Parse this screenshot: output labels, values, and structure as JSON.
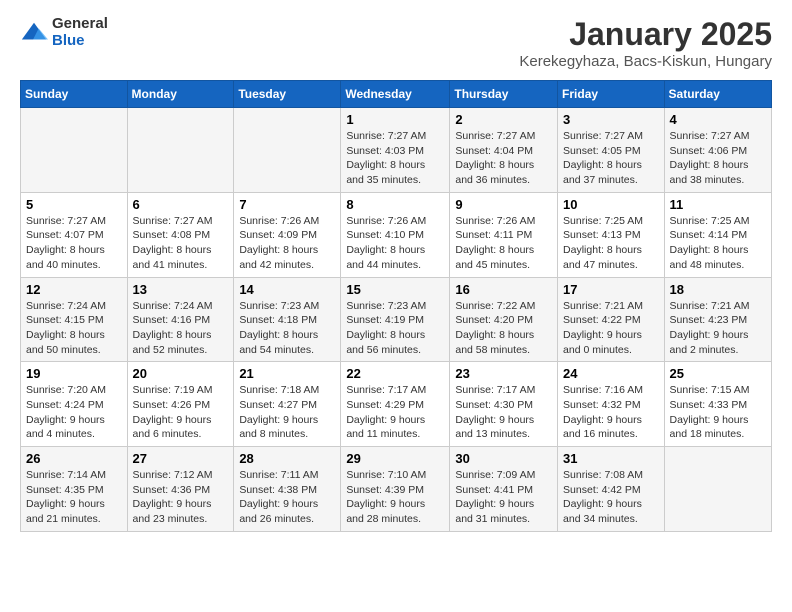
{
  "logo": {
    "general": "General",
    "blue": "Blue"
  },
  "title": "January 2025",
  "location": "Kerekegyhaza, Bacs-Kiskun, Hungary",
  "weekdays": [
    "Sunday",
    "Monday",
    "Tuesday",
    "Wednesday",
    "Thursday",
    "Friday",
    "Saturday"
  ],
  "weeks": [
    [
      {
        "day": "",
        "info": ""
      },
      {
        "day": "",
        "info": ""
      },
      {
        "day": "",
        "info": ""
      },
      {
        "day": "1",
        "info": "Sunrise: 7:27 AM\nSunset: 4:03 PM\nDaylight: 8 hours and 35 minutes."
      },
      {
        "day": "2",
        "info": "Sunrise: 7:27 AM\nSunset: 4:04 PM\nDaylight: 8 hours and 36 minutes."
      },
      {
        "day": "3",
        "info": "Sunrise: 7:27 AM\nSunset: 4:05 PM\nDaylight: 8 hours and 37 minutes."
      },
      {
        "day": "4",
        "info": "Sunrise: 7:27 AM\nSunset: 4:06 PM\nDaylight: 8 hours and 38 minutes."
      }
    ],
    [
      {
        "day": "5",
        "info": "Sunrise: 7:27 AM\nSunset: 4:07 PM\nDaylight: 8 hours and 40 minutes."
      },
      {
        "day": "6",
        "info": "Sunrise: 7:27 AM\nSunset: 4:08 PM\nDaylight: 8 hours and 41 minutes."
      },
      {
        "day": "7",
        "info": "Sunrise: 7:26 AM\nSunset: 4:09 PM\nDaylight: 8 hours and 42 minutes."
      },
      {
        "day": "8",
        "info": "Sunrise: 7:26 AM\nSunset: 4:10 PM\nDaylight: 8 hours and 44 minutes."
      },
      {
        "day": "9",
        "info": "Sunrise: 7:26 AM\nSunset: 4:11 PM\nDaylight: 8 hours and 45 minutes."
      },
      {
        "day": "10",
        "info": "Sunrise: 7:25 AM\nSunset: 4:13 PM\nDaylight: 8 hours and 47 minutes."
      },
      {
        "day": "11",
        "info": "Sunrise: 7:25 AM\nSunset: 4:14 PM\nDaylight: 8 hours and 48 minutes."
      }
    ],
    [
      {
        "day": "12",
        "info": "Sunrise: 7:24 AM\nSunset: 4:15 PM\nDaylight: 8 hours and 50 minutes."
      },
      {
        "day": "13",
        "info": "Sunrise: 7:24 AM\nSunset: 4:16 PM\nDaylight: 8 hours and 52 minutes."
      },
      {
        "day": "14",
        "info": "Sunrise: 7:23 AM\nSunset: 4:18 PM\nDaylight: 8 hours and 54 minutes."
      },
      {
        "day": "15",
        "info": "Sunrise: 7:23 AM\nSunset: 4:19 PM\nDaylight: 8 hours and 56 minutes."
      },
      {
        "day": "16",
        "info": "Sunrise: 7:22 AM\nSunset: 4:20 PM\nDaylight: 8 hours and 58 minutes."
      },
      {
        "day": "17",
        "info": "Sunrise: 7:21 AM\nSunset: 4:22 PM\nDaylight: 9 hours and 0 minutes."
      },
      {
        "day": "18",
        "info": "Sunrise: 7:21 AM\nSunset: 4:23 PM\nDaylight: 9 hours and 2 minutes."
      }
    ],
    [
      {
        "day": "19",
        "info": "Sunrise: 7:20 AM\nSunset: 4:24 PM\nDaylight: 9 hours and 4 minutes."
      },
      {
        "day": "20",
        "info": "Sunrise: 7:19 AM\nSunset: 4:26 PM\nDaylight: 9 hours and 6 minutes."
      },
      {
        "day": "21",
        "info": "Sunrise: 7:18 AM\nSunset: 4:27 PM\nDaylight: 9 hours and 8 minutes."
      },
      {
        "day": "22",
        "info": "Sunrise: 7:17 AM\nSunset: 4:29 PM\nDaylight: 9 hours and 11 minutes."
      },
      {
        "day": "23",
        "info": "Sunrise: 7:17 AM\nSunset: 4:30 PM\nDaylight: 9 hours and 13 minutes."
      },
      {
        "day": "24",
        "info": "Sunrise: 7:16 AM\nSunset: 4:32 PM\nDaylight: 9 hours and 16 minutes."
      },
      {
        "day": "25",
        "info": "Sunrise: 7:15 AM\nSunset: 4:33 PM\nDaylight: 9 hours and 18 minutes."
      }
    ],
    [
      {
        "day": "26",
        "info": "Sunrise: 7:14 AM\nSunset: 4:35 PM\nDaylight: 9 hours and 21 minutes."
      },
      {
        "day": "27",
        "info": "Sunrise: 7:12 AM\nSunset: 4:36 PM\nDaylight: 9 hours and 23 minutes."
      },
      {
        "day": "28",
        "info": "Sunrise: 7:11 AM\nSunset: 4:38 PM\nDaylight: 9 hours and 26 minutes."
      },
      {
        "day": "29",
        "info": "Sunrise: 7:10 AM\nSunset: 4:39 PM\nDaylight: 9 hours and 28 minutes."
      },
      {
        "day": "30",
        "info": "Sunrise: 7:09 AM\nSunset: 4:41 PM\nDaylight: 9 hours and 31 minutes."
      },
      {
        "day": "31",
        "info": "Sunrise: 7:08 AM\nSunset: 4:42 PM\nDaylight: 9 hours and 34 minutes."
      },
      {
        "day": "",
        "info": ""
      }
    ]
  ]
}
